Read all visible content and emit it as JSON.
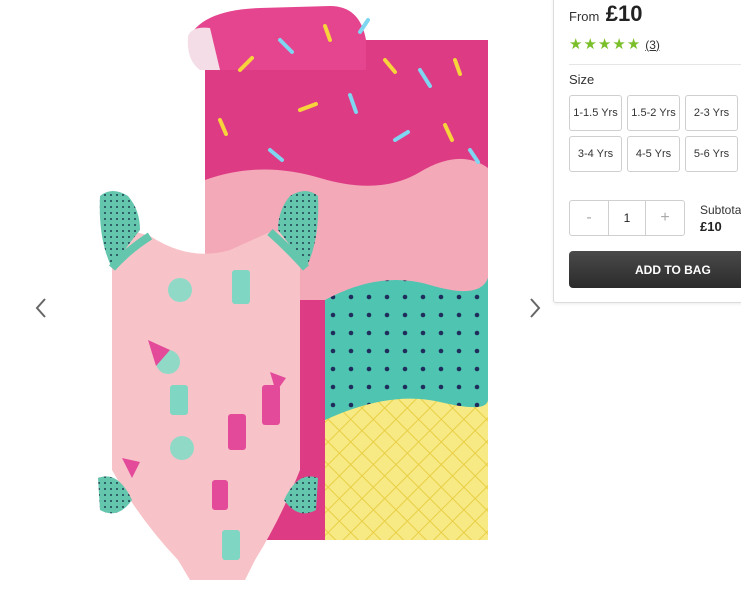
{
  "gallery": {
    "image_alt": "Pink ice cream print swimsuit and hooded towel set",
    "prev_icon": "chevron-left-icon",
    "next_icon": "chevron-right-icon"
  },
  "product": {
    "price_prefix": "From",
    "price": "£10",
    "rating_stars": 5,
    "review_count": "(3)"
  },
  "size": {
    "label": "Size",
    "options": [
      "1-1.5 Yrs",
      "1.5-2 Yrs",
      "2-3 Yrs",
      "3-4 Yrs",
      "4-5 Yrs",
      "5-6 Yrs"
    ]
  },
  "quantity": {
    "minus": "-",
    "value": "1",
    "plus": "+"
  },
  "subtotal": {
    "label": "Subtotal",
    "value": "£10"
  },
  "cart": {
    "add_label": "ADD TO BAG"
  },
  "colors": {
    "star": "#7bbf2a",
    "button_dark": "#333333",
    "towel_pink": "#dd3b84",
    "towel_light_pink": "#f3a9b8",
    "towel_teal": "#4fc4b1",
    "towel_yellow": "#f7e984",
    "swimsuit_pink": "#f8c3c8",
    "ruffle_teal": "#6cc9b0"
  }
}
